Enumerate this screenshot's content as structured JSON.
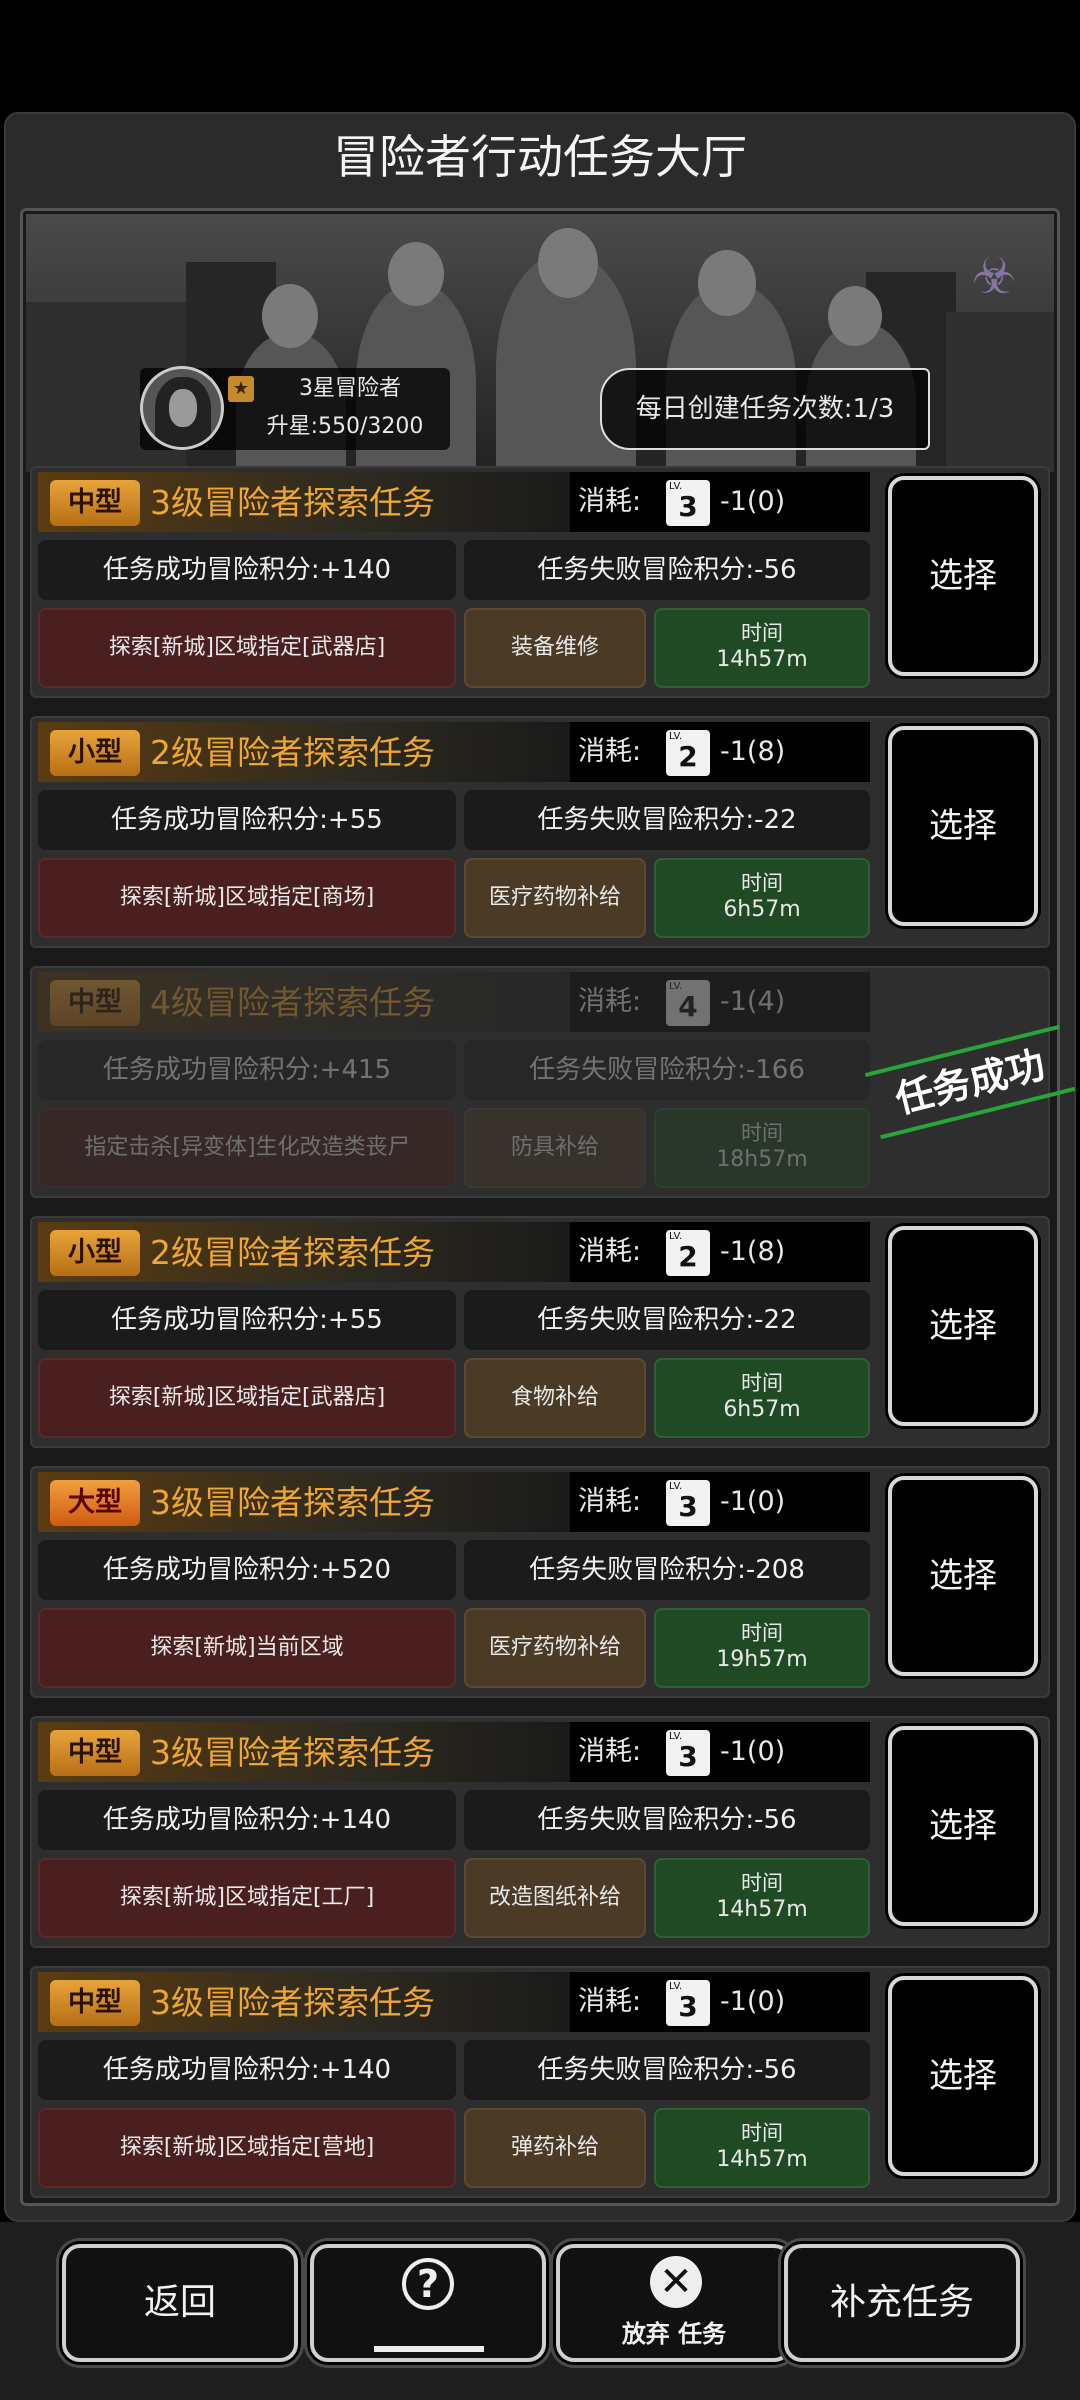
{
  "header": {
    "title": "冒险者行动任务大厅"
  },
  "player": {
    "rank_label": "3星冒险者",
    "star_progress": "升星:550/3200"
  },
  "daily_create": "每日创建任务次数:1/3",
  "cost_label": "消耗:",
  "select_label": "选择",
  "time_label": "时间",
  "lv_prefix": "LV.",
  "missions": [
    {
      "size": "中型",
      "title": "3级冒险者探索任务",
      "lv": "3",
      "cost": "-1(0)",
      "success": "任务成功冒险积分:+140",
      "fail": "任务失败冒险积分:-56",
      "objective": "探索[新城]区域指定[武器店]",
      "reward": "装备维修",
      "time": "14h57m",
      "completed": false
    },
    {
      "size": "小型",
      "title": "2级冒险者探索任务",
      "lv": "2",
      "cost": "-1(8)",
      "success": "任务成功冒险积分:+55",
      "fail": "任务失败冒险积分:-22",
      "objective": "探索[新城]区域指定[商场]",
      "reward": "医疗药物补给",
      "time": "6h57m",
      "completed": false
    },
    {
      "size": "中型",
      "title": "4级冒险者探索任务",
      "lv": "4",
      "cost": "-1(4)",
      "success": "任务成功冒险积分:+415",
      "fail": "任务失败冒险积分:-166",
      "objective": "指定击杀[异变体]生化改造类丧尸",
      "reward": "防具补给",
      "time": "18h57m",
      "completed": true,
      "stamp": "任务成功"
    },
    {
      "size": "小型",
      "title": "2级冒险者探索任务",
      "lv": "2",
      "cost": "-1(8)",
      "success": "任务成功冒险积分:+55",
      "fail": "任务失败冒险积分:-22",
      "objective": "探索[新城]区域指定[武器店]",
      "reward": "食物补给",
      "time": "6h57m",
      "completed": false
    },
    {
      "size": "大型",
      "title": "3级冒险者探索任务",
      "lv": "3",
      "cost": "-1(0)",
      "success": "任务成功冒险积分:+520",
      "fail": "任务失败冒险积分:-208",
      "objective": "探索[新城]当前区域",
      "reward": "医疗药物补给",
      "time": "19h57m",
      "completed": false
    },
    {
      "size": "中型",
      "title": "3级冒险者探索任务",
      "lv": "3",
      "cost": "-1(0)",
      "success": "任务成功冒险积分:+140",
      "fail": "任务失败冒险积分:-56",
      "objective": "探索[新城]区域指定[工厂]",
      "reward": "改造图纸补给",
      "time": "14h57m",
      "completed": false
    },
    {
      "size": "中型",
      "title": "3级冒险者探索任务",
      "lv": "3",
      "cost": "-1(0)",
      "success": "任务成功冒险积分:+140",
      "fail": "任务失败冒险积分:-56",
      "objective": "探索[新城]区域指定[营地]",
      "reward": "弹药补给",
      "time": "14h57m",
      "completed": false
    }
  ],
  "footer": {
    "back": "返回",
    "abandon": "放弃 任务",
    "replenish": "补充任务"
  },
  "icons": {
    "help": "help-question-icon",
    "abandon": "close-x-icon",
    "emblem": "biohazard-emblem-icon",
    "rank": "rank-badge-icon"
  }
}
